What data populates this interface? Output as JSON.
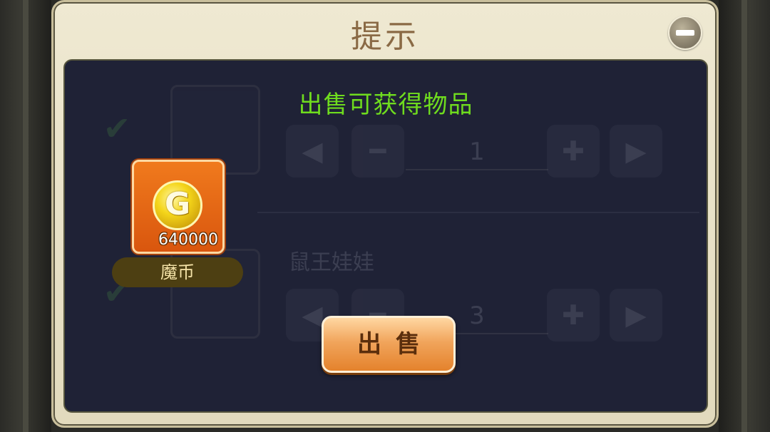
{
  "dialog": {
    "title": "提示",
    "close_icon": "minus-circle-icon"
  },
  "panel": {
    "heading": "出售可获得物品"
  },
  "reward_item": {
    "icon": "gold-coin-icon",
    "coin_letter": "G",
    "count": "640000",
    "name": "魔币"
  },
  "background_list": {
    "rows": [
      {
        "quantity": "1",
        "name": ""
      },
      {
        "quantity": "3",
        "name": "鼠王娃娃"
      }
    ]
  },
  "sell_button": {
    "label": "出售"
  },
  "colors": {
    "heading_green": "#6fdc1e",
    "panel_bg": "#1f2236",
    "frame_cream": "#efe9d2",
    "button_orange": "#e4822c"
  }
}
